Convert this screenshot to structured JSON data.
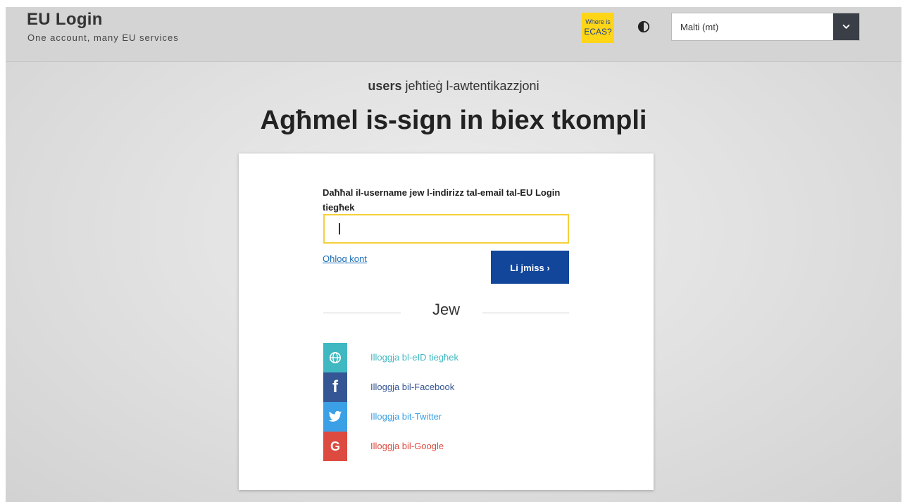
{
  "header": {
    "title": "EU Login",
    "subtitle": "One account, many EU services",
    "ecas_line1": "Where is",
    "ecas_line2": "ECAS?",
    "language": "Malti (mt)"
  },
  "main": {
    "user_bold": "users",
    "auth_suffix": " jeħtieġ l-awtentikazzjoni",
    "heading": "Agħmel is-sign in biex tkompli",
    "field_label": "Daħħal il-username jew l-indirizz tal-email tal-EU Login tiegħek",
    "input_value": "",
    "create_account": "Oħloq kont",
    "next_button": "Li jmiss  ›",
    "or_text": "Jew"
  },
  "social": [
    {
      "label": "Illoggja bl-eID tiegħek",
      "icon": "globe-icon",
      "color": "#3fb8c2"
    },
    {
      "label": "Illoggja bil-Facebook",
      "icon": "facebook-icon",
      "color": "#355694"
    },
    {
      "label": "Illoggja bit-Twitter",
      "icon": "twitter-icon",
      "color": "#3ba0e6"
    },
    {
      "label": "Illoggja bil-Google",
      "icon": "google-icon",
      "color": "#dd4a3f"
    }
  ],
  "colors": {
    "ecas_bg": "#ffd617",
    "primary_button": "#11469b",
    "input_border": "#f5d03a",
    "link": "#1f6fb5"
  }
}
